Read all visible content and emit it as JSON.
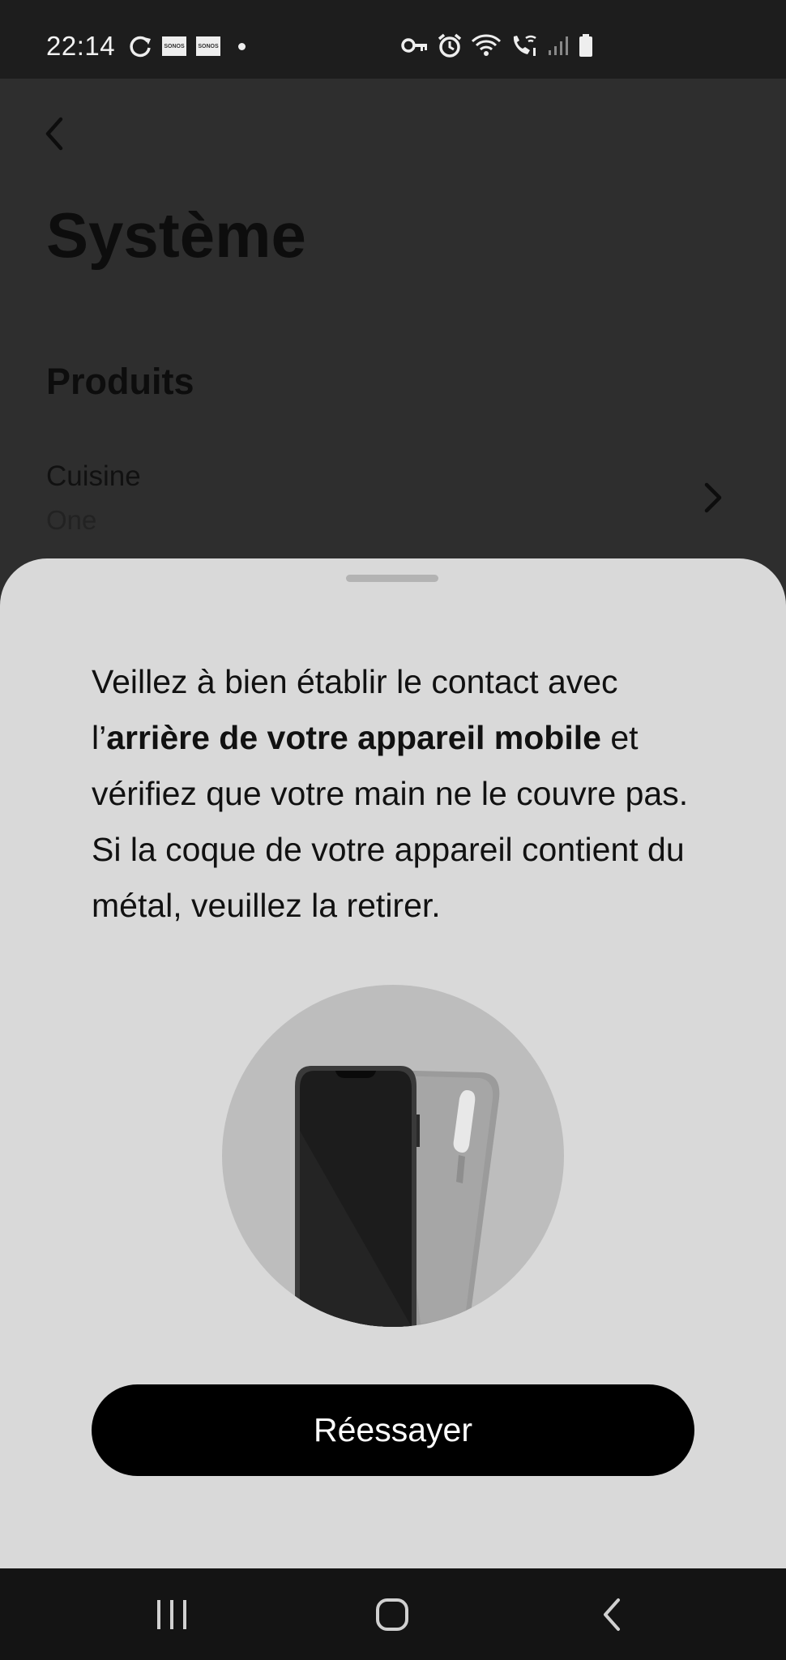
{
  "status_bar": {
    "time": "22:14",
    "sonos_badge": "SONOS",
    "left_icons": [
      "sync-icon",
      "sonos-badge-icon",
      "sonos-badge-icon",
      "dot-icon"
    ],
    "right_icons": [
      "key-icon",
      "alarm-icon",
      "wifi-icon",
      "wifi-call-icon",
      "signal-icon",
      "battery-icon"
    ]
  },
  "background_page": {
    "title": "Système",
    "section_title": "Produits",
    "product": {
      "name": "Cuisine",
      "model": "One"
    }
  },
  "sheet": {
    "message_part1": "Veillez à bien établir le contact avec l’",
    "message_bold": "arrière de votre appareil mobile",
    "message_part2": " et vérifiez que votre main ne le couvre pas. Si la coque de votre appareil contient du métal, veuillez la retirer.",
    "retry_label": "Réessayer"
  },
  "colors": {
    "sheet_bg": "#d9d9d9",
    "button_bg": "#000000",
    "page_bg": "#2e2e2e"
  }
}
